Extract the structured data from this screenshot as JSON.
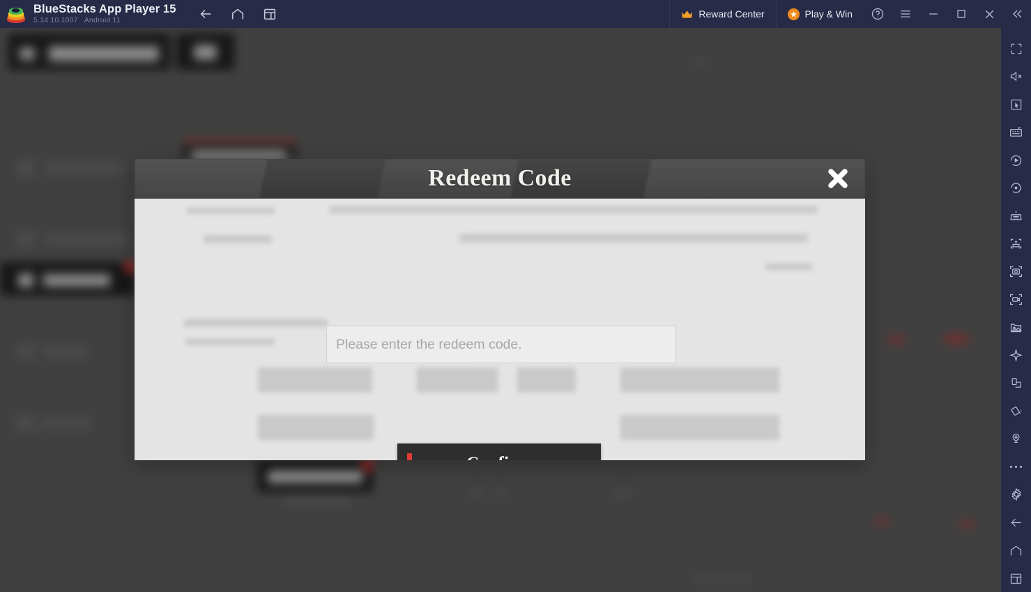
{
  "titlebar": {
    "app_name": "BlueStacks App Player 15",
    "version": "5.14.10.1007",
    "android_version": "Android 11",
    "logo_icon": "bluestacks-logo",
    "nav": [
      {
        "name": "back",
        "icon": "arrow-left-icon"
      },
      {
        "name": "home",
        "icon": "home-icon"
      },
      {
        "name": "multi-instance",
        "icon": "instance-manager-icon"
      }
    ],
    "reward_center": {
      "label": "Reward Center",
      "icon": "crown-icon"
    },
    "play_and_win": {
      "label": "Play & Win",
      "icon": "star-badge-icon"
    },
    "window_buttons": [
      {
        "name": "help",
        "icon": "help-circle-icon"
      },
      {
        "name": "menu",
        "icon": "hamburger-menu-icon"
      },
      {
        "name": "minimize",
        "icon": "minimize-icon"
      },
      {
        "name": "maximize",
        "icon": "maximize-icon"
      },
      {
        "name": "close",
        "icon": "close-icon"
      },
      {
        "name": "collapse-toolbar",
        "icon": "chevron-double-left-icon"
      }
    ],
    "bg_color": "#272b47",
    "text_color": "#eef0f7"
  },
  "sidebar": {
    "items": [
      {
        "name": "fullscreen",
        "icon": "fullscreen-icon"
      },
      {
        "name": "mute",
        "icon": "speaker-mute-icon"
      },
      {
        "name": "cursor-mode",
        "icon": "cursor-pointer-icon"
      },
      {
        "name": "game-controls",
        "icon": "keyboard-controls-icon"
      },
      {
        "name": "macro-recorder",
        "icon": "play-circle-icon"
      },
      {
        "name": "script",
        "icon": "rotate-record-icon"
      },
      {
        "name": "multi-instance-sync",
        "icon": "sync-instance-icon"
      },
      {
        "name": "install-apk",
        "icon": "apk-install-icon"
      },
      {
        "name": "screenshot",
        "icon": "camera-icon"
      },
      {
        "name": "record-screen",
        "icon": "video-record-icon"
      },
      {
        "name": "media-manager",
        "icon": "gallery-icon"
      },
      {
        "name": "eco-mode",
        "icon": "airplane-icon"
      },
      {
        "name": "rotate-screen",
        "icon": "rotate-screen-icon"
      },
      {
        "name": "shake",
        "icon": "shake-device-icon"
      },
      {
        "name": "location",
        "icon": "location-pin-icon"
      },
      {
        "name": "more-options",
        "icon": "more-dots-icon"
      },
      {
        "name": "settings",
        "icon": "gear-icon"
      },
      {
        "name": "android-back",
        "icon": "arrow-left-icon"
      },
      {
        "name": "android-home",
        "icon": "home-icon"
      },
      {
        "name": "android-recents",
        "icon": "recent-apps-icon"
      }
    ],
    "bg_color": "#272b47"
  },
  "modal": {
    "title": "Redeem Code",
    "close_icon": "close-x-icon",
    "input": {
      "placeholder": "Please enter the redeem code.",
      "value": ""
    },
    "confirm_label": "Confirm",
    "accent_color": "#e23b36",
    "header_bg": "#434343",
    "body_bg": "#f0f0f0",
    "button_bg": "#2e2e2e"
  },
  "background": {
    "description": "blurred game account settings screen behind modal"
  }
}
